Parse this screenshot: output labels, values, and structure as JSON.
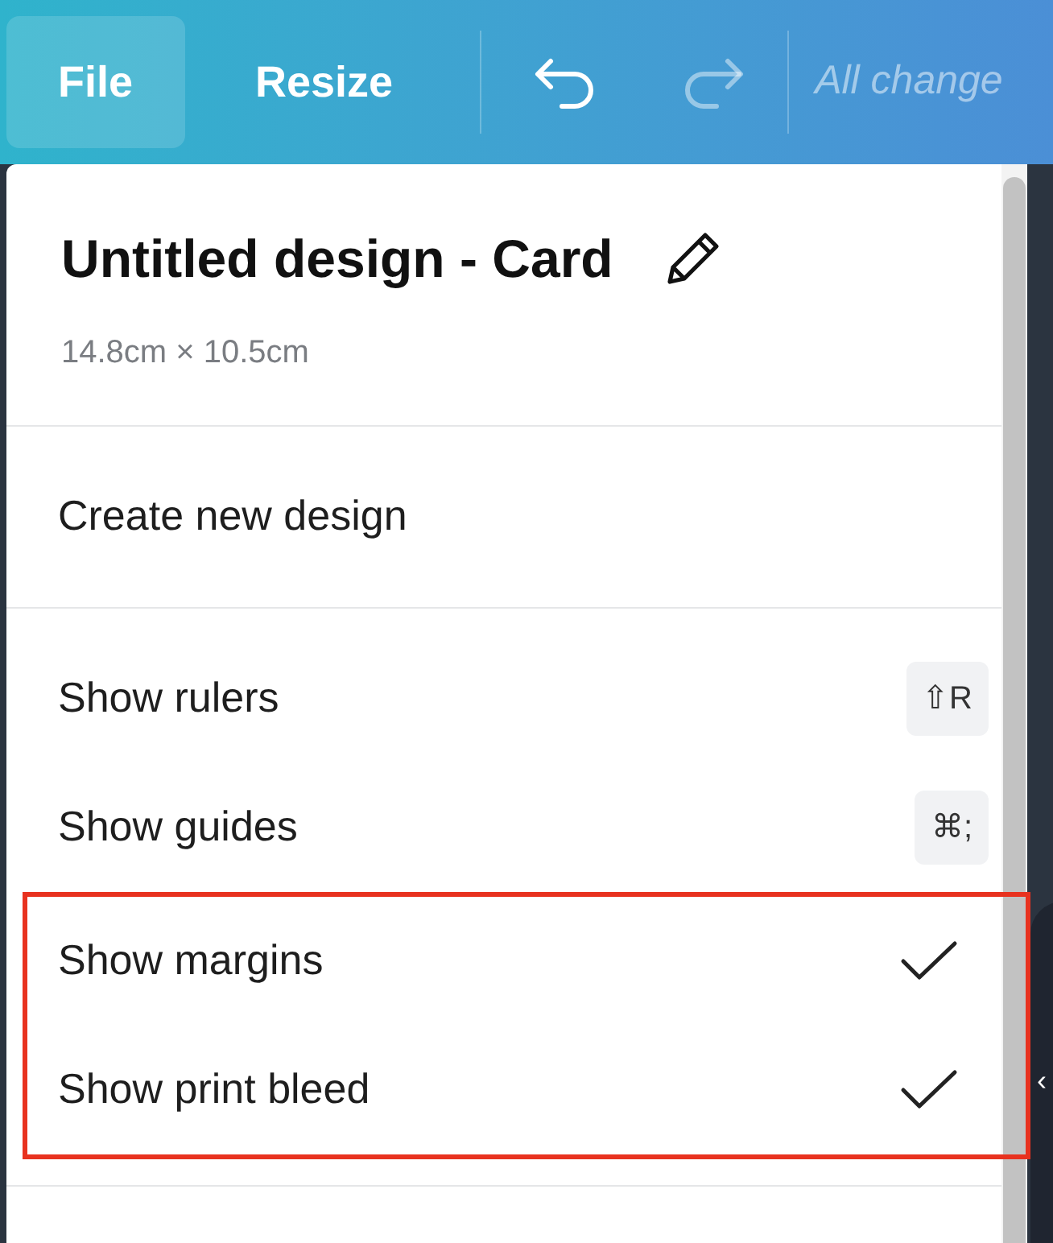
{
  "toolbar": {
    "buttons": [
      {
        "kind": "text",
        "label": "File",
        "selected": true
      },
      {
        "kind": "text",
        "label": "Resize",
        "selected": false
      },
      {
        "kind": "undo",
        "disabled": false
      },
      {
        "kind": "redo",
        "disabled": true
      }
    ],
    "status": "All change",
    "side_tab": "‹"
  },
  "menu": {
    "title": "Untitled design - Card",
    "size": "14.8cm × 10.5cm",
    "sections": [
      [
        {
          "kind": "action",
          "label": "Create new design"
        }
      ],
      [
        {
          "kind": "shortcut",
          "label": "Show rulers",
          "shortcut": "⇧R"
        },
        {
          "kind": "shortcut",
          "label": "Show guides",
          "shortcut": "⌘;"
        },
        {
          "kind": "toggle",
          "label": "Show margins",
          "checked": true,
          "highlighted": true
        },
        {
          "kind": "toggle",
          "label": "Show print bleed",
          "checked": true,
          "highlighted": true
        }
      ]
    ]
  }
}
